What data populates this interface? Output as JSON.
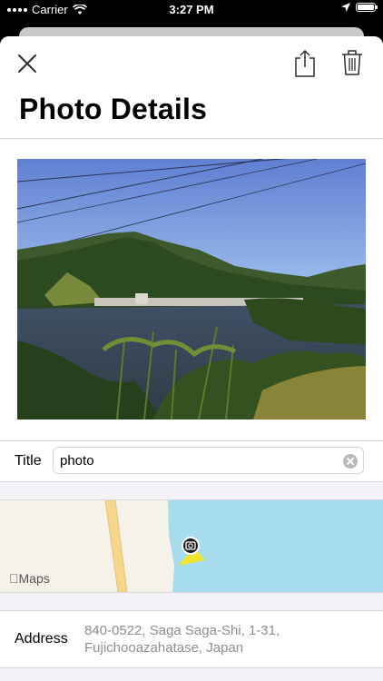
{
  "status_bar": {
    "carrier": "Carrier",
    "time": "3:27 PM",
    "battery_level": 1.0
  },
  "header": {
    "title": "Photo Details",
    "icons": [
      "close-icon",
      "share-icon",
      "trash-icon"
    ]
  },
  "title_field": {
    "label": "Title",
    "value": "photo"
  },
  "map": {
    "attribution": "Maps",
    "pin_icon": "camera-icon"
  },
  "address": {
    "label": "Address",
    "value": "840-0522, Saga Saga-Shi, 1-31, Fujichooazahatase, Japan"
  },
  "colors": {
    "water": "#a7dcef",
    "land": "#f5f2ea",
    "road": "#f6d58c",
    "pin_cone": "#f7e51c",
    "secondary_text": "#8e8e93"
  }
}
